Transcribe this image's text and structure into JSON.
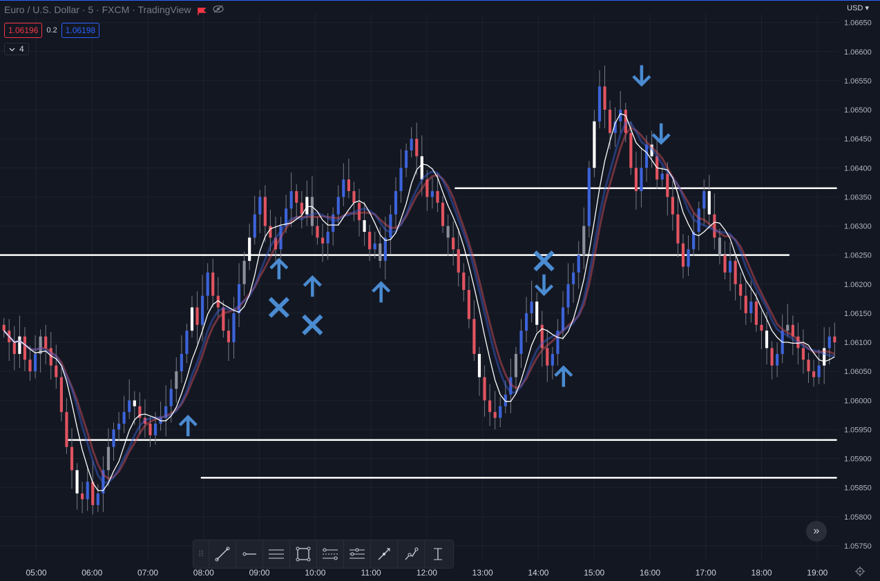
{
  "header": {
    "title": "Euro / U.S. Dollar · 5 · FXCM · TradingView",
    "sell_price": "1.06196",
    "spread": "0.2",
    "buy_price": "1.06198",
    "indicator_count": "4",
    "currency": "USD"
  },
  "colors": {
    "background": "#131722",
    "up": "#3c63d9",
    "down": "#e15460",
    "neutral_white": "#ffffff",
    "arrow": "#4a8bd1"
  },
  "toolbar": {
    "tools": [
      "trend-line-icon",
      "horizontal-ray-icon",
      "parallel-channel-icon",
      "rectangle-icon",
      "fib-retracement-icon",
      "pitchfork-icon",
      "brush-icon",
      "path-icon",
      "measure-icon"
    ]
  },
  "chart_data": {
    "type": "candlestick",
    "title": "Euro / U.S. Dollar · 5 · FXCM · TradingView",
    "xlabel": "",
    "ylabel": "",
    "x_ticks": [
      "05:00",
      "06:00",
      "07:00",
      "08:00",
      "09:00",
      "10:00",
      "11:00",
      "12:00",
      "13:00",
      "14:00",
      "15:00",
      "16:00",
      "17:00",
      "18:00",
      "19:00"
    ],
    "x_tick_hours": [
      5,
      6,
      7,
      8,
      9,
      10,
      11,
      12,
      13,
      14,
      15,
      16,
      17,
      18,
      19
    ],
    "x_range_hours": [
      4.35,
      19.38
    ],
    "y_ticks": [
      "1.05750",
      "1.05800",
      "1.05850",
      "1.05900",
      "1.05950",
      "1.06000",
      "1.06050",
      "1.06100",
      "1.06150",
      "1.06200",
      "1.06250",
      "1.06300",
      "1.06350",
      "1.06400",
      "1.06450",
      "1.06500",
      "1.06550",
      "1.06600",
      "1.06650"
    ],
    "ylim": [
      1.05725,
      1.06665
    ],
    "grid": true,
    "closes": [
      1.0612,
      1.061,
      1.0608,
      1.0611,
      1.0607,
      1.0605,
      1.0608,
      1.0611,
      1.0609,
      1.0606,
      1.0604,
      1.0598,
      1.0592,
      1.0588,
      1.0584,
      1.0583,
      1.0586,
      1.0582,
      1.0584,
      1.0588,
      1.0592,
      1.0595,
      1.0596,
      1.0598,
      1.06,
      1.0599,
      1.0597,
      1.0596,
      1.0594,
      1.0596,
      1.0597,
      1.0599,
      1.0602,
      1.0605,
      1.0608,
      1.0612,
      1.0616,
      1.0613,
      1.0618,
      1.0622,
      1.0618,
      1.0616,
      1.0612,
      1.061,
      1.0615,
      1.062,
      1.0624,
      1.0628,
      1.0632,
      1.0635,
      1.063,
      1.0628,
      1.0626,
      1.063,
      1.0633,
      1.0636,
      1.0634,
      1.0632,
      1.0635,
      1.063,
      1.0628,
      1.0627,
      1.0629,
      1.0632,
      1.0635,
      1.0638,
      1.0636,
      1.0634,
      1.0631,
      1.0629,
      1.0626,
      1.0627,
      1.0624,
      1.0628,
      1.0632,
      1.0636,
      1.064,
      1.0643,
      1.0645,
      1.0642,
      1.0638,
      1.0635,
      1.0636,
      1.0634,
      1.063,
      1.0628,
      1.0626,
      1.0622,
      1.0619,
      1.0614,
      1.0608,
      1.0604,
      1.06,
      1.0598,
      1.0597,
      1.0599,
      1.0601,
      1.0604,
      1.0608,
      1.0612,
      1.0615,
      1.0617,
      1.0613,
      1.0609,
      1.0606,
      1.0608,
      1.0612,
      1.0616,
      1.062,
      1.0622,
      1.0625,
      1.063,
      1.064,
      1.0648,
      1.0654,
      1.065,
      1.0646,
      1.0648,
      1.065,
      1.0646,
      1.064,
      1.0636,
      1.064,
      1.0644,
      1.0642,
      1.0638,
      1.0639,
      1.0635,
      1.0632,
      1.0627,
      1.0623,
      1.0626,
      1.0629,
      1.0633,
      1.0636,
      1.0632,
      1.0628,
      1.0625,
      1.0622,
      1.0624,
      1.062,
      1.0618,
      1.0615,
      1.0617,
      1.0613,
      1.0612,
      1.0609,
      1.0606,
      1.0608,
      1.0612,
      1.0613,
      1.0611,
      1.0609,
      1.0607,
      1.0605,
      1.0604,
      1.0606,
      1.0609,
      1.0611,
      1.061
    ],
    "fast_ma_color": "#ffffff",
    "slow_ma_colors": [
      "#e15460",
      "#3c63d9"
    ],
    "horizontal_levels": [
      {
        "price": 1.06365,
        "from_hour": 12.5,
        "to_hour": 19.35
      },
      {
        "price": 1.0625,
        "from_hour": 4.35,
        "to_hour": 18.5
      },
      {
        "price": 1.05932,
        "from_hour": 5.55,
        "to_hour": 19.35
      },
      {
        "price": 1.05867,
        "from_hour": 7.95,
        "to_hour": 19.35
      }
    ],
    "annotations": [
      {
        "type": "arrow-up",
        "hour": 7.72,
        "price": 1.05955
      },
      {
        "type": "arrow-up",
        "hour": 9.35,
        "price": 1.06225
      },
      {
        "type": "cross",
        "hour": 9.35,
        "price": 1.0616
      },
      {
        "type": "arrow-up",
        "hour": 9.95,
        "price": 1.06195
      },
      {
        "type": "cross",
        "hour": 9.95,
        "price": 1.0613
      },
      {
        "type": "arrow-up",
        "hour": 11.18,
        "price": 1.06185
      },
      {
        "type": "cross",
        "hour": 14.1,
        "price": 1.0624
      },
      {
        "type": "arrow-down",
        "hour": 14.1,
        "price": 1.062
      },
      {
        "type": "arrow-up",
        "hour": 14.45,
        "price": 1.0604
      },
      {
        "type": "arrow-down",
        "hour": 15.85,
        "price": 1.0656
      },
      {
        "type": "arrow-down",
        "hour": 16.2,
        "price": 1.0646
      }
    ]
  }
}
